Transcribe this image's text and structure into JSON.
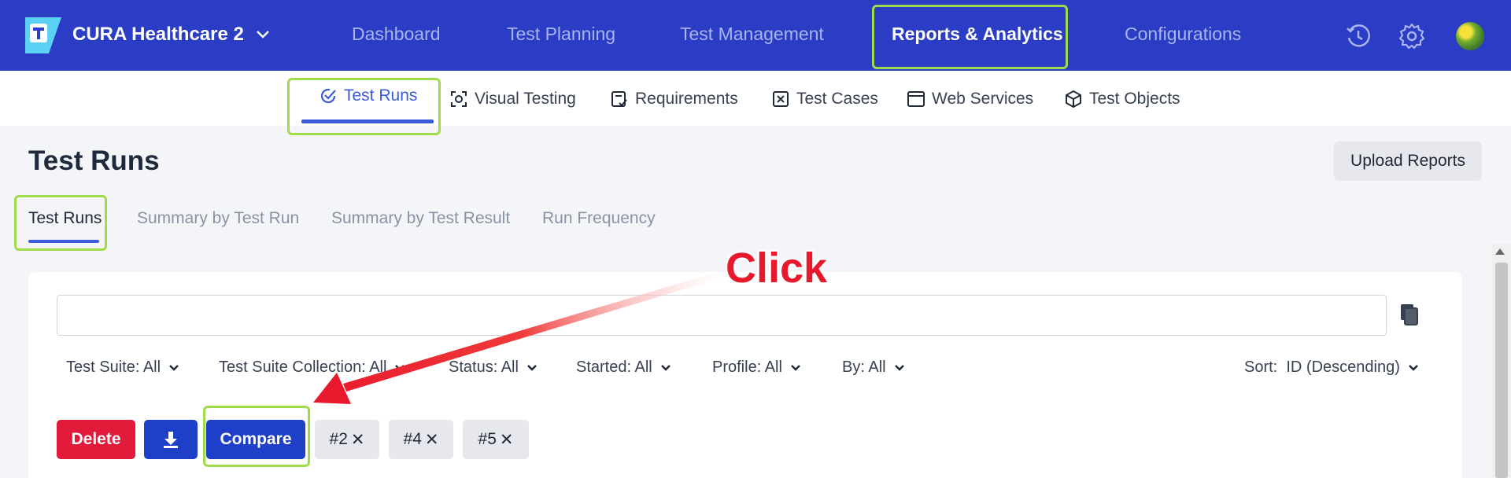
{
  "topbar": {
    "project_name": "CURA Healthcare 2",
    "nav": [
      "Dashboard",
      "Test Planning",
      "Test Management",
      "Reports & Analytics",
      "Configurations"
    ],
    "active_nav": "Reports & Analytics",
    "icons": [
      "history-icon",
      "gear-icon",
      "avatar"
    ]
  },
  "subnav": {
    "items": [
      "Test Runs",
      "Visual Testing",
      "Requirements",
      "Test Cases",
      "Web Services",
      "Test Objects"
    ],
    "active": "Test Runs"
  },
  "page": {
    "title": "Test Runs",
    "upload_label": "Upload Reports",
    "tabs": [
      "Test Runs",
      "Summary by Test Run",
      "Summary by Test Result",
      "Run Frequency"
    ],
    "active_tab": "Test Runs"
  },
  "filters": {
    "test_suite": "Test Suite: All",
    "test_suite_collection": "Test Suite Collection: All",
    "status": "Status: All",
    "started": "Started: All",
    "profile": "Profile: All",
    "by": "By: All",
    "sort": "Sort:  ID (Descending)"
  },
  "actions": {
    "delete_label": "Delete",
    "compare_label": "Compare",
    "chips": [
      "#2",
      "#4",
      "#5"
    ]
  },
  "annotation": {
    "text": "Click",
    "color": "#e8192c"
  },
  "colors": {
    "topbar": "#2b3dc4",
    "accent": "#3b5bdb",
    "highlight": "#9fdc4a",
    "delete": "#e31b3b",
    "primary_button": "#1e40c8"
  }
}
